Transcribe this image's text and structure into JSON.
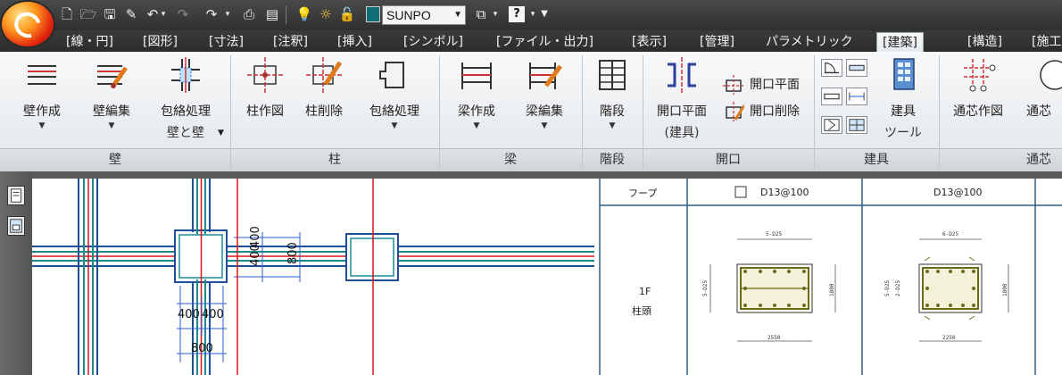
{
  "quick_access": {
    "current_layer": "SUNPO"
  },
  "tabs": [
    {
      "label": "[線・円]"
    },
    {
      "label": "[図形]"
    },
    {
      "label": "[寸法]"
    },
    {
      "label": "[注釈]"
    },
    {
      "label": "[挿入]"
    },
    {
      "label": "[シンボル]"
    },
    {
      "label": "[ファイル・出力]"
    },
    {
      "label": "[表示]"
    },
    {
      "label": "[管理]"
    },
    {
      "label": "パラメトリック"
    },
    {
      "label": "[建築]"
    },
    {
      "label": "[構造]"
    },
    {
      "label": "[施工"
    }
  ],
  "ribbon": {
    "panels": {
      "wall": "壁",
      "column": "柱",
      "beam": "梁",
      "stairs": "階段",
      "opening": "開口",
      "fittings": "建具",
      "gridline": "通芯"
    },
    "buttons": {
      "wall_create": "壁作成",
      "wall_edit": "壁編集",
      "wall_wrap": "包絡処理",
      "wall_wrap_sub": "壁と壁",
      "column_draw": "柱作図",
      "column_delete": "柱削除",
      "column_wrap": "包絡処理",
      "beam_create": "梁作成",
      "beam_edit": "梁編集",
      "stairs": "階段",
      "opening_plan_fitting": "開口平面",
      "opening_plan_fitting_sub": "(建具)",
      "opening_plan": "開口平面",
      "opening_delete": "開口削除",
      "fitting_tool": "建具",
      "fitting_tool_sub": "ツール",
      "grid_draw": "通芯作図",
      "grid_more": "通芯"
    }
  },
  "drawing": {
    "dims": {
      "d400a": "400",
      "d400b": "400",
      "d800a": "800",
      "d400c": "400",
      "d400d": "400",
      "d800b": "800"
    },
    "table": {
      "hoop_label": "フープ",
      "col1_header": "D13@100",
      "col2_header": "D13@100",
      "floor": "1F",
      "position": "柱頭",
      "sec1": {
        "top": "5-D25",
        "left": "5-D25",
        "right": "1800",
        "bottom": "2550"
      },
      "sec2": {
        "top": "6-D25",
        "left1": "5-D25",
        "left2": "2-D25",
        "right": "1800",
        "bottom": "2250"
      }
    }
  },
  "colors": {
    "wall_blue": "#1f4f99",
    "wall_teal": "#1b8a8f",
    "grid_red": "#d8161a",
    "dim_blue": "#2a5fd0",
    "rebar_olive": "#6b6a1a"
  }
}
